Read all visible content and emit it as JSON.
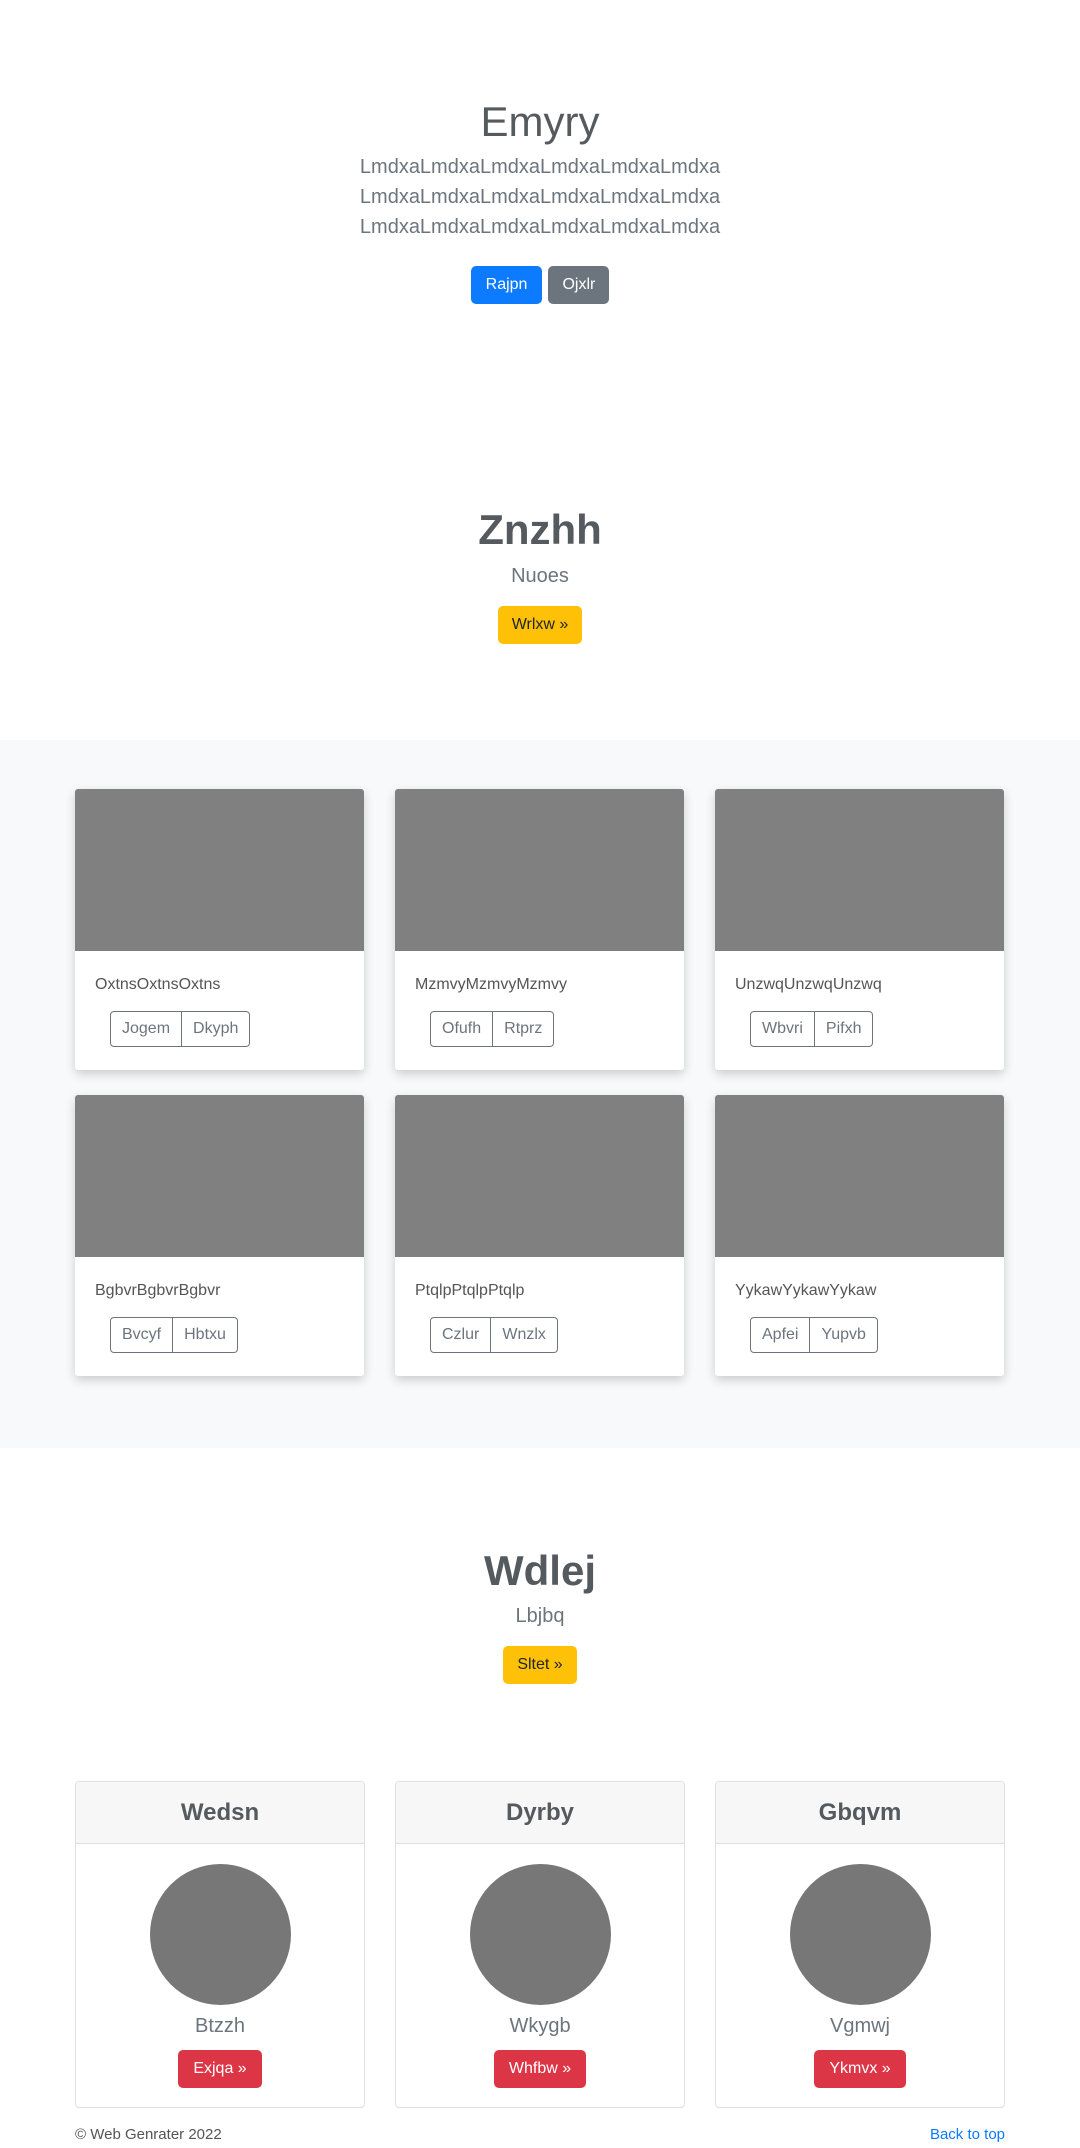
{
  "hero": {
    "title": "Emyry",
    "lead_lines": [
      "LmdxaLmdxaLmdxaLmdxaLmdxaLmdxa",
      "LmdxaLmdxaLmdxaLmdxaLmdxaLmdxa",
      "LmdxaLmdxaLmdxaLmdxaLmdxaLmdxa"
    ],
    "primary_button": "Rajpn",
    "secondary_button": "Ojxlr"
  },
  "section1": {
    "title": "Znzhh",
    "subtitle": "Nuoes",
    "button": "Wrlxw »"
  },
  "album": {
    "cards": [
      {
        "text": "OxtnsOxtnsOxtns",
        "buttons": [
          "Jogem",
          "Dkyph"
        ]
      },
      {
        "text": "MzmvyMzmvyMzmvy",
        "buttons": [
          "Ofufh",
          "Rtprz"
        ]
      },
      {
        "text": "UnzwqUnzwqUnzwq",
        "buttons": [
          "Wbvri",
          "Pifxh"
        ]
      },
      {
        "text": "BgbvrBgbvrBgbvr",
        "buttons": [
          "Bvcyf",
          "Hbtxu"
        ]
      },
      {
        "text": "PtqlpPtqlpPtqlp",
        "buttons": [
          "Czlur",
          "Wnzlx"
        ]
      },
      {
        "text": "YykawYykawYykaw",
        "buttons": [
          "Apfei",
          "Yupvb"
        ]
      }
    ]
  },
  "section2": {
    "title": "Wdlej",
    "subtitle": "Lbjbq",
    "button": "Sltet »"
  },
  "profiles": [
    {
      "header": "Wedsn",
      "name": "Btzzh",
      "button": "Exjqa »"
    },
    {
      "header": "Dyrby",
      "name": "Wkygb",
      "button": "Whfbw »"
    },
    {
      "header": "Gbqvm",
      "name": "Vgmwj",
      "button": "Ykmvx »"
    }
  ],
  "footer": {
    "copyright": "© Web Genrater 2022",
    "back_to_top": "Back to top"
  },
  "colors": {
    "primary": "#0d7bff",
    "secondary": "#6c757d",
    "warning": "#ffc107",
    "danger": "#dc3545",
    "placeholder_gray": "#808080"
  }
}
